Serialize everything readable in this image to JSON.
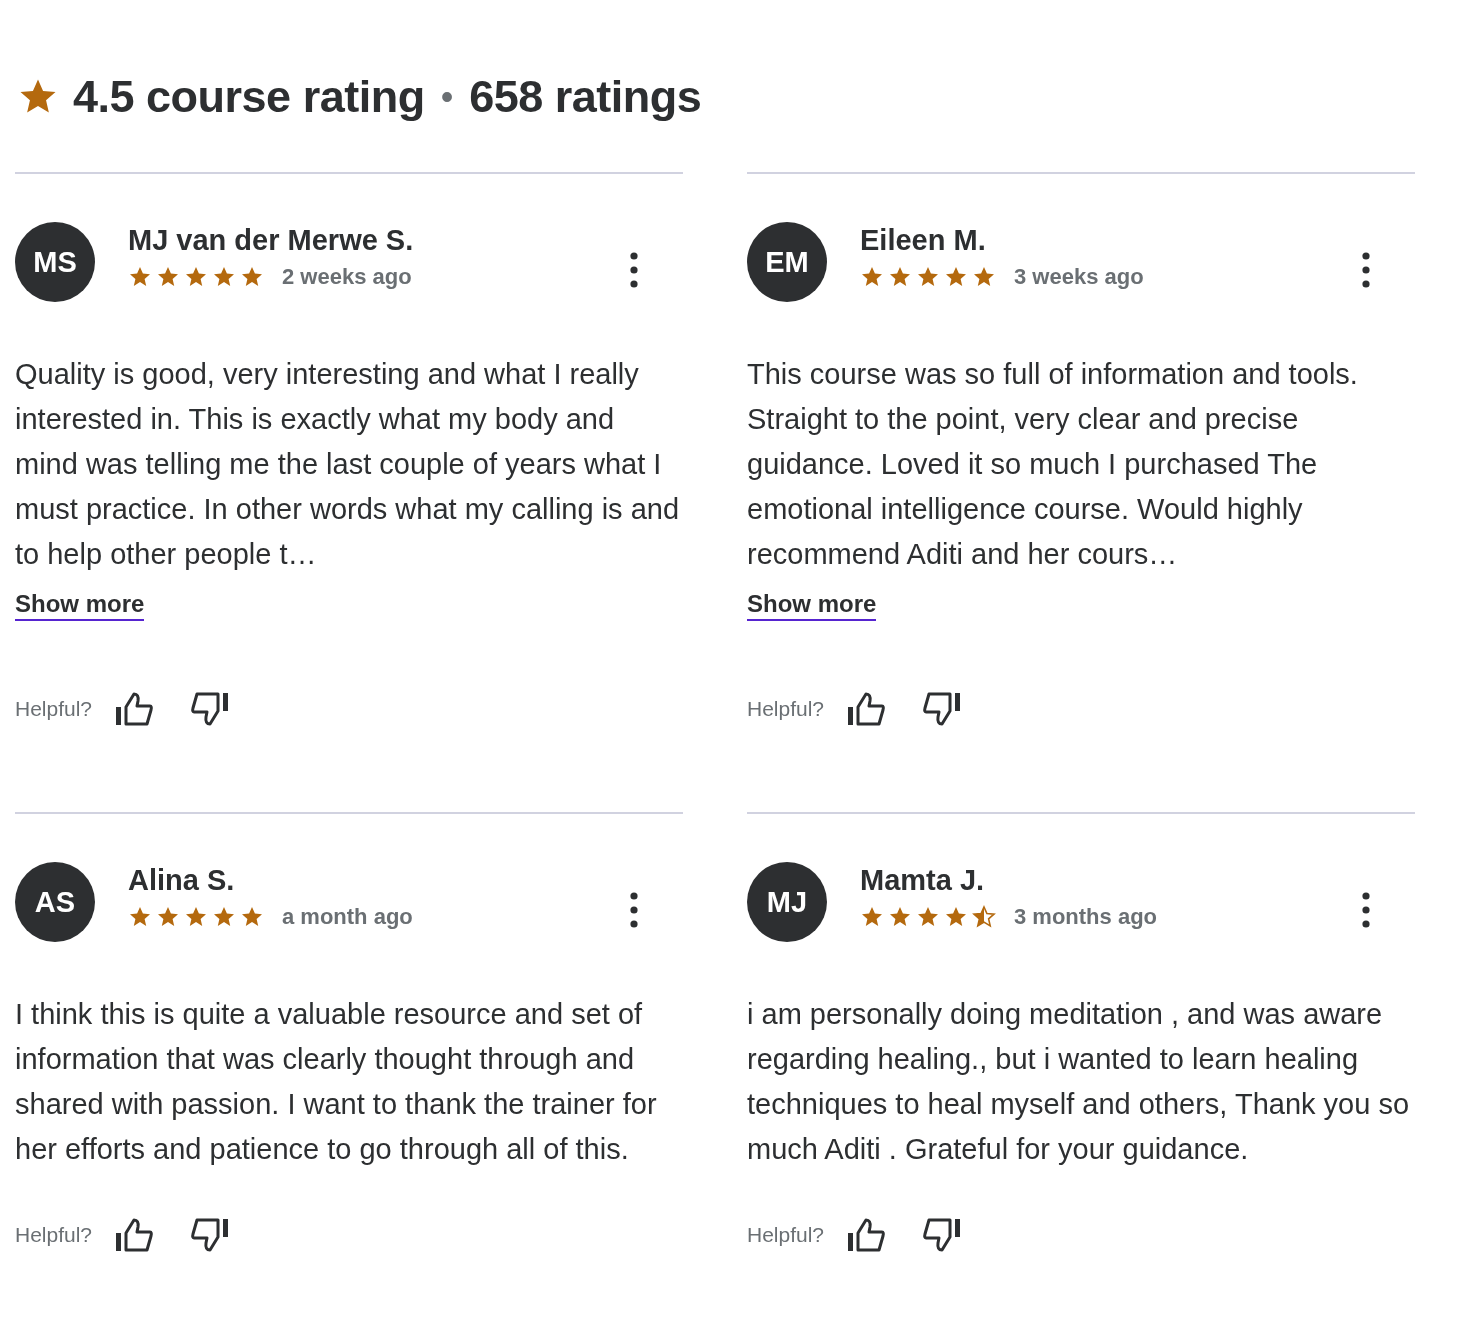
{
  "header": {
    "rating": "4.5 course rating",
    "separator": "•",
    "count": "658 ratings"
  },
  "reviews": [
    {
      "initials": "MS",
      "name": "MJ van der Merwe S.",
      "stars": 5,
      "time": "2 weeks ago",
      "text": "Quality is good, very interesting and what I really interested in. This is exactly what my body and mind was telling me the last couple of years what I must practice. In other words what my calling is and to help other people t…",
      "show_more": "Show more",
      "helpful": "Helpful?"
    },
    {
      "initials": "EM",
      "name": "Eileen M.",
      "stars": 5,
      "time": "3 weeks ago",
      "text": "This course was so full of information and tools. Straight to the point, very clear and precise guidance. Loved it so much I purchased The emotional intelligence course. Would highly recommend Aditi and her cours…",
      "show_more": "Show more",
      "helpful": "Helpful?"
    },
    {
      "initials": "AS",
      "name": "Alina S.",
      "stars": 5,
      "time": "a month ago",
      "text": "I think this is quite a valuable resource and set of information that was clearly thought through and shared with passion. I want to thank the trainer for her efforts and patience to go through all of this.",
      "helpful": "Helpful?"
    },
    {
      "initials": "MJ",
      "name": "Mamta J.",
      "stars": 4.5,
      "time": "3 months ago",
      "text": "i am personally doing meditation , and was aware regarding healing., but i wanted to learn healing techniques to heal myself and others, Thank you so much Aditi . Grateful for your guidance.",
      "helpful": "Helpful?"
    }
  ]
}
